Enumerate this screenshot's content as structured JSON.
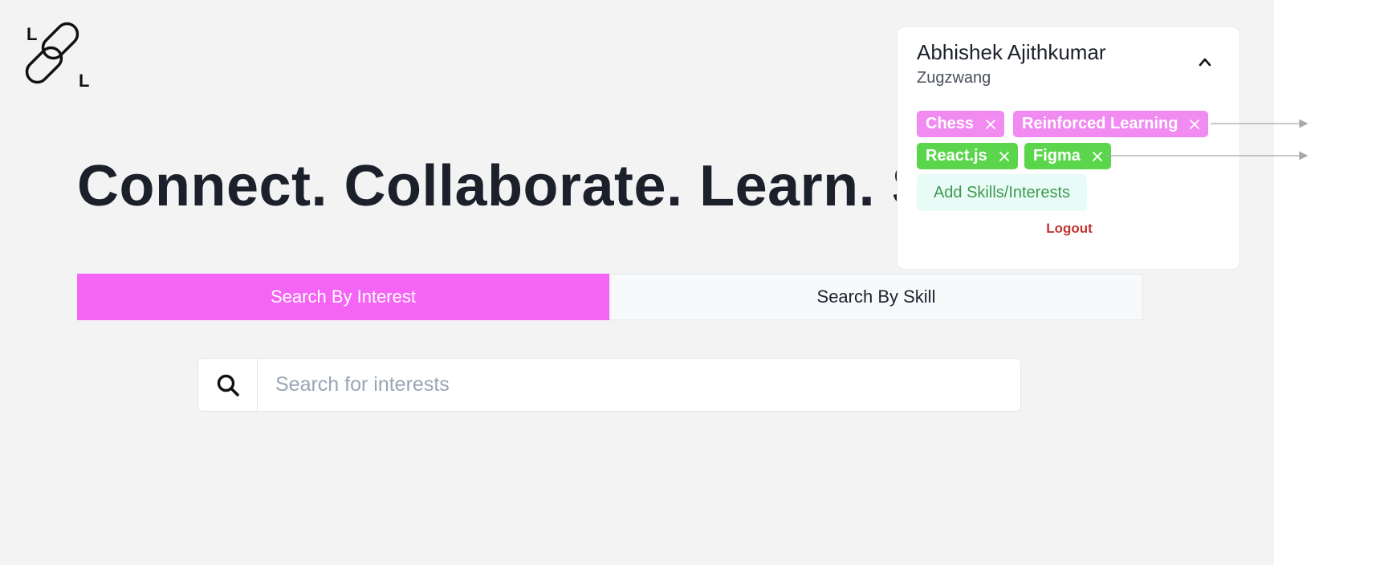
{
  "brand": {
    "logo_letter_top": "L",
    "logo_letter_bottom": "L"
  },
  "hero": {
    "headline": "Connect. Collaborate. Learn. Se"
  },
  "tabs": [
    {
      "label": "Search By Interest",
      "active": true
    },
    {
      "label": "Search By Skill",
      "active": false
    }
  ],
  "search": {
    "placeholder": "Search for interests",
    "value": ""
  },
  "profile": {
    "name": "Abhishek Ajithkumar",
    "subtitle": "Zugzwang",
    "interests": [
      "Chess",
      "Reinforced Learning"
    ],
    "skills": [
      "React.js",
      "Figma"
    ],
    "add_label": "Add Skills/Interests",
    "logout_label": "Logout"
  },
  "colors": {
    "interest_tab_active": "#f565f5",
    "interest_tag": "#f18af1",
    "skill_tag": "#5bd64c",
    "add_button_text": "#3e9a50",
    "logout": "#c03434",
    "headline": "#1b202b",
    "page_background": "#f3f3f3"
  },
  "icons": {
    "logo": "chain-link-icon",
    "search": "search-icon",
    "collapse": "chevron-up-icon",
    "remove": "close-icon"
  }
}
